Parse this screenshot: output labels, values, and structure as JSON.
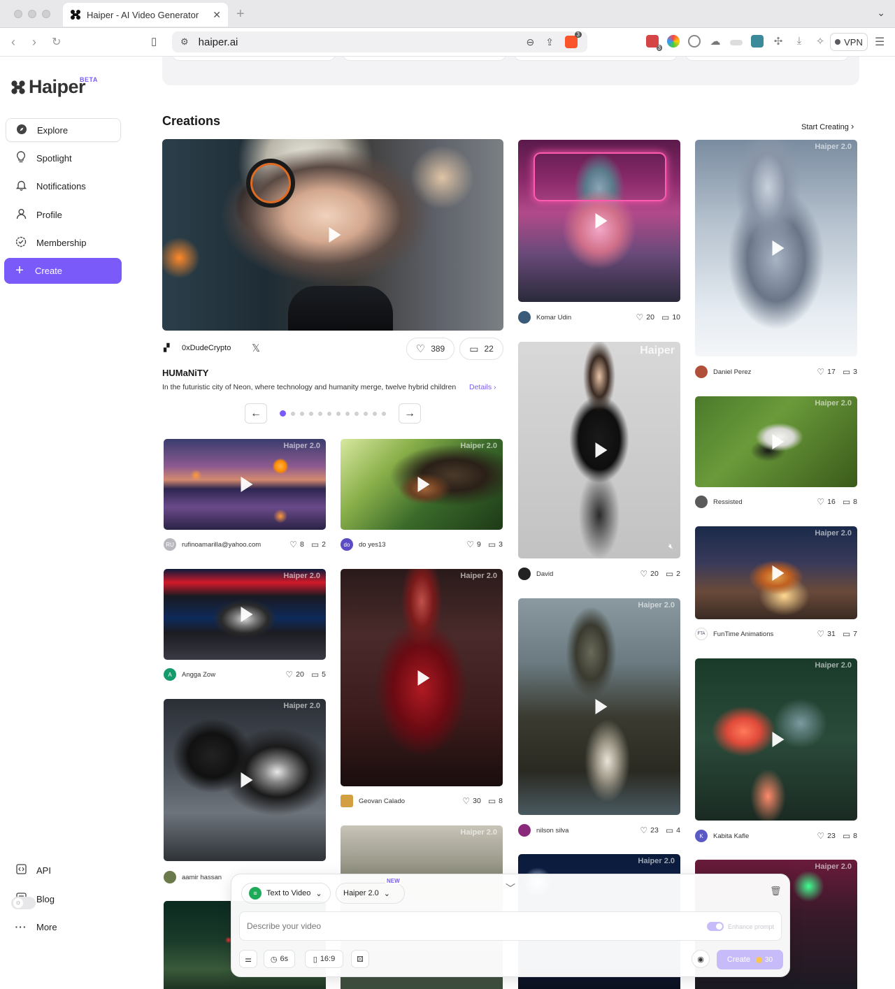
{
  "browser": {
    "tab_title": "Haiper - AI Video Generator",
    "url": "haiper.ai",
    "brave_count": "3",
    "ext_badge": "3",
    "vpn_label": "VPN",
    "icons": [
      "back-icon",
      "forward-icon",
      "reload-icon",
      "bookmark-icon",
      "site-settings-icon",
      "zoom-icon",
      "share-icon",
      "brave-shield-icon",
      "extensions-icon",
      "download-icon",
      "menu-icon"
    ]
  },
  "sidebar": {
    "logo": "Haiper",
    "beta": "BETA",
    "items": [
      {
        "label": "Explore",
        "icon": "compass-icon"
      },
      {
        "label": "Spotlight",
        "icon": "bulb-icon"
      },
      {
        "label": "Notifications",
        "icon": "bell-icon"
      },
      {
        "label": "Profile",
        "icon": "user-icon"
      },
      {
        "label": "Membership",
        "icon": "badge-icon"
      },
      {
        "label": "Create",
        "icon": "plus-icon"
      }
    ],
    "footer": [
      {
        "label": "API",
        "icon": "code-icon"
      },
      {
        "label": "Blog",
        "icon": "blog-icon"
      },
      {
        "label": "More",
        "icon": "more-icon"
      }
    ]
  },
  "main": {
    "section_title": "Creations",
    "start_creating": "Start Creating",
    "featured": {
      "author": "0xDudeCrypto",
      "likes": "389",
      "comments": "22",
      "title": "HUMaNiTY",
      "description": "In the futuristic city of Neon, where technology and humanity merge, twelve hybrid children",
      "details": "Details",
      "slides": 12,
      "active_slide": 1
    },
    "cards": [
      {
        "author": "rufinoamarilla@yahoo.com",
        "avatar": "RU",
        "likes": "8",
        "comments": "2"
      },
      {
        "author": "do yes13",
        "avatar": "do",
        "likes": "9",
        "comments": "3"
      },
      {
        "author": "Angga Zow",
        "avatar": "A",
        "likes": "20",
        "comments": "5"
      },
      {
        "author": "Geovan Calado",
        "avatar": "",
        "likes": "30",
        "comments": "8"
      },
      {
        "author": "aamir hassan",
        "avatar": "",
        "likes": "",
        "comments": ""
      },
      {
        "author": "Komar Udin",
        "avatar": "",
        "likes": "20",
        "comments": "10"
      },
      {
        "author": "David",
        "avatar": "",
        "likes": "20",
        "comments": "2"
      },
      {
        "author": "nilson silva",
        "avatar": "",
        "likes": "23",
        "comments": "4"
      },
      {
        "author": "Daniel Perez",
        "avatar": "",
        "likes": "17",
        "comments": "3"
      },
      {
        "author": "Ressisted",
        "avatar": "",
        "likes": "16",
        "comments": "8"
      },
      {
        "author": "FunTime Animations",
        "avatar": "FTA",
        "likes": "31",
        "comments": "7"
      },
      {
        "author": "Kabita Kafle",
        "avatar": "K",
        "likes": "23",
        "comments": "8"
      }
    ],
    "watermarks": {
      "v2": "Haiper 2.0",
      "v1": "Haiper"
    }
  },
  "prompt": {
    "mode": "Text to Video",
    "model": "Haiper 2.0",
    "model_badge": "NEW",
    "placeholder": "Describe your video",
    "enhance": "Enhance prompt",
    "duration": "6s",
    "ratio": "16:9",
    "create": "Create",
    "credits": "30"
  },
  "colors": {
    "accent": "#7a5af8",
    "accent_light": "#c7bcf9"
  }
}
